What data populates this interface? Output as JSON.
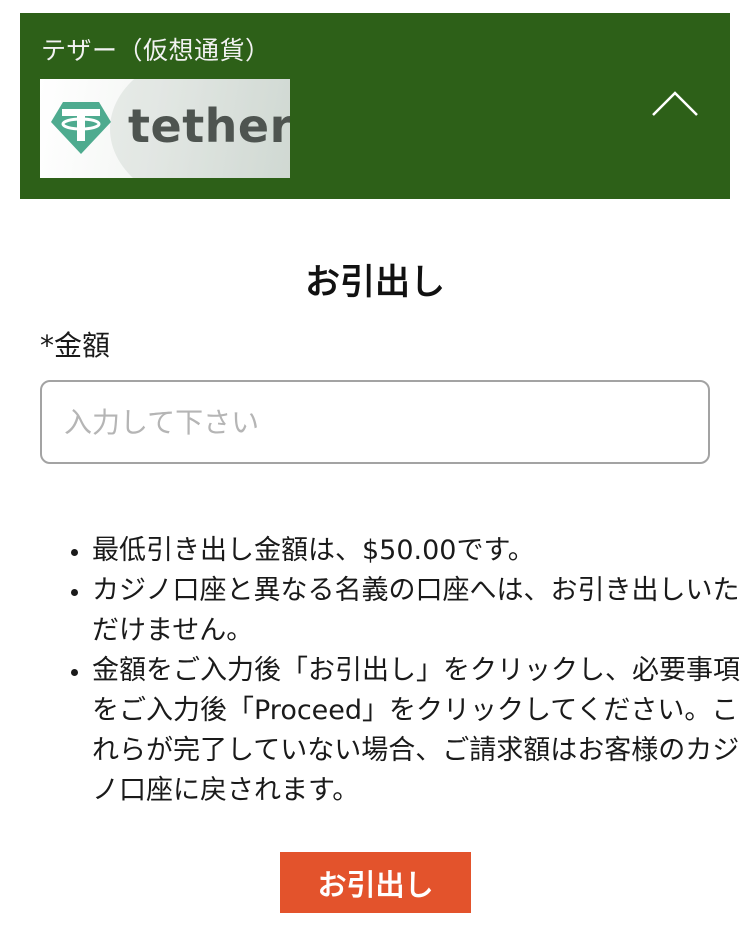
{
  "payment_method": {
    "title": "テザー（仮想通貨）",
    "logo_text": "tether",
    "logo_color": "#4eab8f",
    "collapse_icon": "chevron-up-icon",
    "header_color": "#2d6018"
  },
  "withdrawal": {
    "heading": "お引出し",
    "amount_label": "*金額",
    "amount_placeholder": "入力して下さい",
    "amount_value": "",
    "notes": [
      "最低引き出し金額は、$50.00です。",
      "カジノ口座と異なる名義の口座へは、お引き出しいただけません。",
      "金額をご入力後「お引出し」をクリックし、必要事項をご入力後「Proceed」をクリックしてください。これらが完了していない場合、ご請求額はお客様のカジノ口座に戻されます。"
    ],
    "submit_label": "お引出し",
    "submit_color": "#e3532c"
  }
}
